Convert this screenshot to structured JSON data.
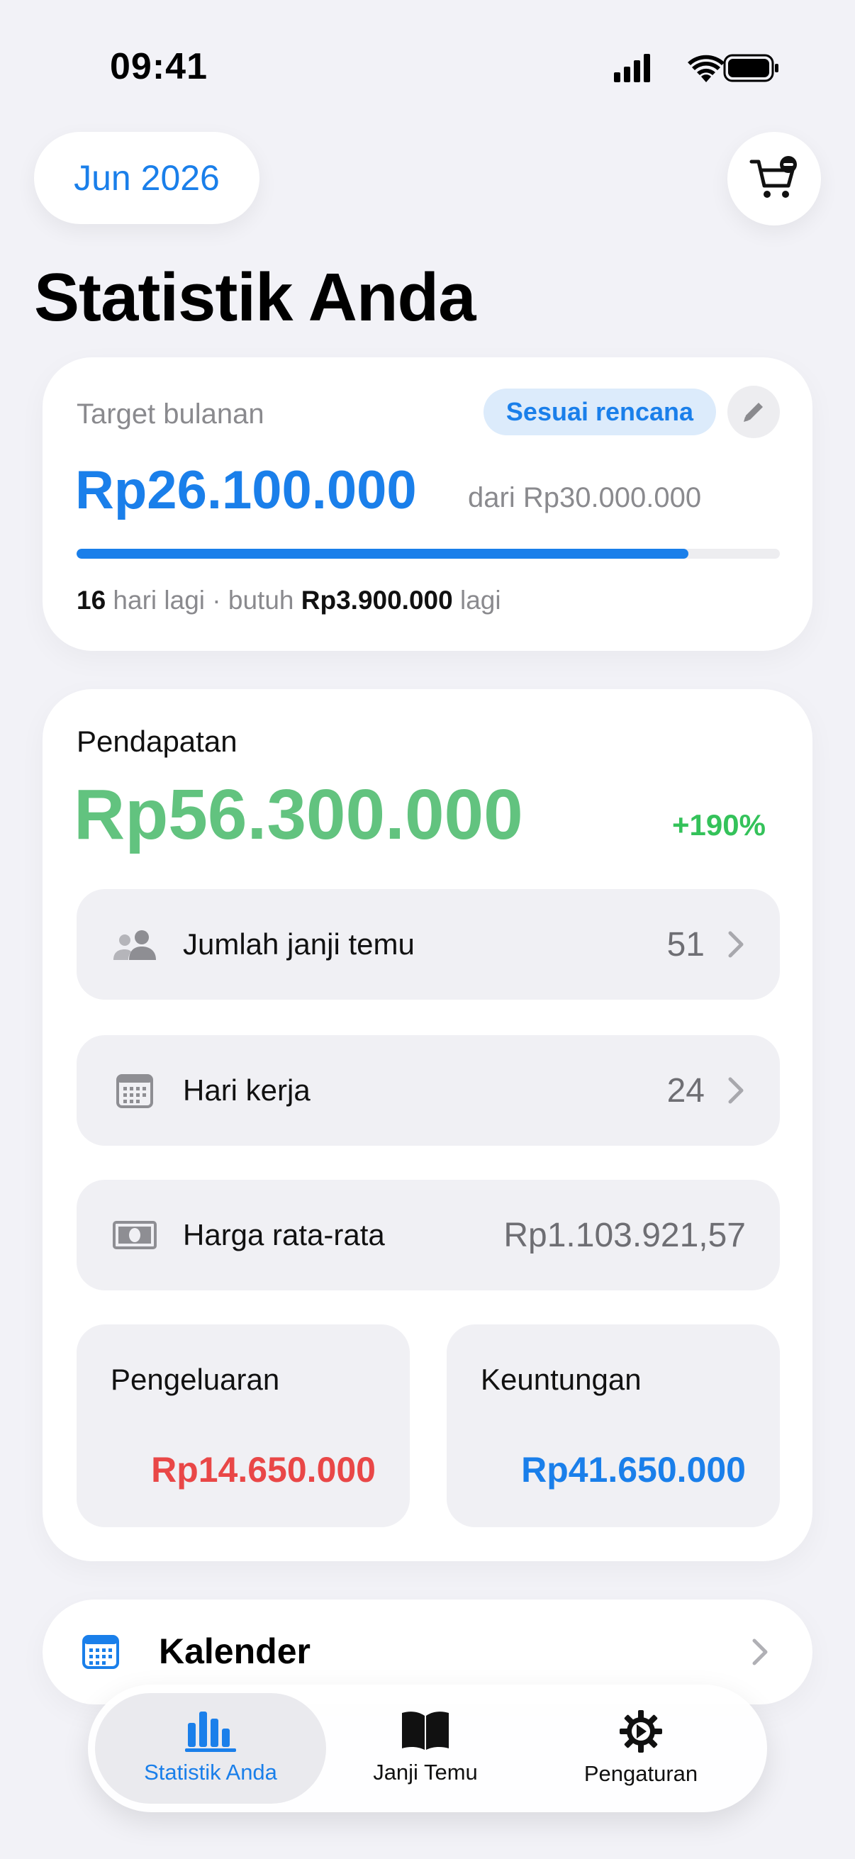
{
  "status_bar": {
    "time": "09:41"
  },
  "header": {
    "month": "Jun 2026",
    "title": "Statistik Anda"
  },
  "target": {
    "label": "Target bulanan",
    "badge": "Sesuai rencana",
    "amount": "Rp26.100.000",
    "of_text": "dari Rp30.000.000",
    "progress": 0.87,
    "days": "16",
    "days_suffix": " hari lagi · butuh ",
    "needed": "Rp3.900.000",
    "needed_suffix": " lagi"
  },
  "income": {
    "label": "Pendapatan",
    "amount": "Rp56.300.000",
    "change": "+190%",
    "rows": [
      {
        "label": "Jumlah janji temu",
        "value": "51"
      },
      {
        "label": "Hari kerja",
        "value": "24"
      },
      {
        "label": "Harga rata-rata",
        "value": "Rp1.103.921,57"
      }
    ],
    "expenses": {
      "label": "Pengeluaran",
      "value": "Rp14.650.000"
    },
    "profit": {
      "label": "Keuntungan",
      "value": "Rp41.650.000"
    }
  },
  "calendar": {
    "label": "Kalender"
  },
  "tabs": [
    {
      "label": "Statistik Anda",
      "icon": "bar-chart-icon",
      "active": true
    },
    {
      "label": "Janji Temu",
      "icon": "book-icon",
      "active": false
    },
    {
      "label": "Pengaturan",
      "icon": "gear-icon",
      "active": false
    }
  ],
  "colors": {
    "accent": "#1A7FEA",
    "income": "#62C37F",
    "change": "#34C25A",
    "expense": "#E94747",
    "background": "#F2F2F7"
  }
}
